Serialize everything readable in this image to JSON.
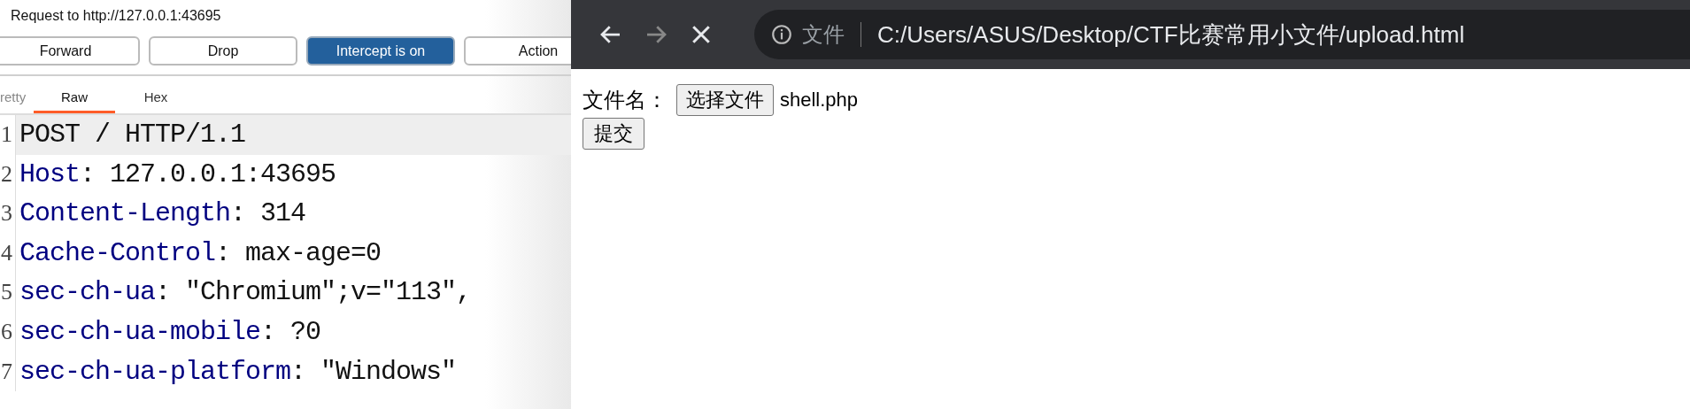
{
  "proxy": {
    "title": "Request to http://127.0.0.1:43695",
    "buttons": [
      {
        "label": "Forward",
        "kind": "plain"
      },
      {
        "label": "Drop",
        "kind": "plain"
      },
      {
        "label": "Intercept is on",
        "kind": "toggle",
        "on": true
      },
      {
        "label": "Action",
        "kind": "plain"
      }
    ],
    "tabs": [
      {
        "label": "retty",
        "selected": false
      },
      {
        "label": "Raw",
        "selected": true
      },
      {
        "label": "Hex",
        "selected": false
      }
    ],
    "lines": [
      {
        "number": "1",
        "kind": "request-line",
        "value": "POST / HTTP/1.1",
        "highlighted": true
      },
      {
        "number": "2",
        "kind": "header",
        "name": "Host",
        "value": ": 127.0.0.1:43695",
        "highlighted": false
      },
      {
        "number": "3",
        "kind": "header",
        "name": "Content-Length",
        "value": ": 314",
        "highlighted": false
      },
      {
        "number": "4",
        "kind": "header",
        "name": "Cache-Control",
        "value": ": max-age=0",
        "highlighted": false
      },
      {
        "number": "5",
        "kind": "header",
        "name": "sec-ch-ua",
        "value": ": \"Chromium\";v=\"113\",",
        "highlighted": false
      },
      {
        "number": "6",
        "kind": "header",
        "name": "sec-ch-ua-mobile",
        "value": ": ?0",
        "highlighted": false
      },
      {
        "number": "7",
        "kind": "header",
        "name": "sec-ch-ua-platform",
        "value": ": \"Windows\"",
        "highlighted": false
      }
    ]
  },
  "browser": {
    "nav": [
      {
        "kind": "back",
        "disabled": false
      },
      {
        "kind": "forward",
        "disabled": true
      },
      {
        "kind": "stop",
        "disabled": false
      }
    ],
    "address": {
      "scheme_label": "文件",
      "url": "C:/Users/ASUS/Desktop/CTF比赛常用小文件/upload.html"
    },
    "page": {
      "label": "文件名：",
      "file_button": "选择文件",
      "file_name": "shell.php",
      "submit": "提交"
    }
  }
}
